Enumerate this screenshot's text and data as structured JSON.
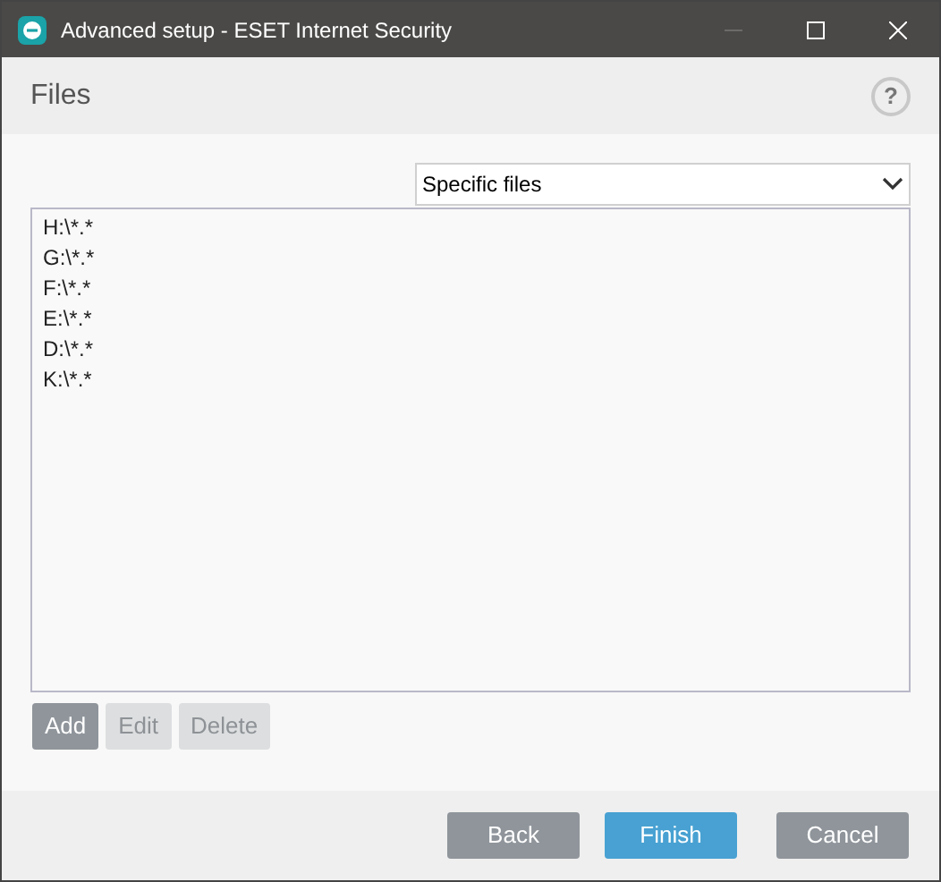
{
  "window": {
    "title": "Advanced setup - ESET Internet Security",
    "minimize_disabled": true
  },
  "header": {
    "title": "Files",
    "help": "?"
  },
  "dropdown": {
    "value": "Specific files"
  },
  "list": {
    "items": [
      "H:\\*.*",
      "G:\\*.*",
      "F:\\*.*",
      "E:\\*.*",
      "D:\\*.*",
      "K:\\*.*"
    ]
  },
  "list_buttons": [
    {
      "label": "Add",
      "disabled": false
    },
    {
      "label": "Edit",
      "disabled": true
    },
    {
      "label": "Delete",
      "disabled": true
    }
  ],
  "footer_buttons": [
    {
      "label": "Back",
      "kind": "secondary"
    },
    {
      "label": "Finish",
      "kind": "primary"
    },
    {
      "label": "Cancel",
      "kind": "secondary"
    }
  ]
}
